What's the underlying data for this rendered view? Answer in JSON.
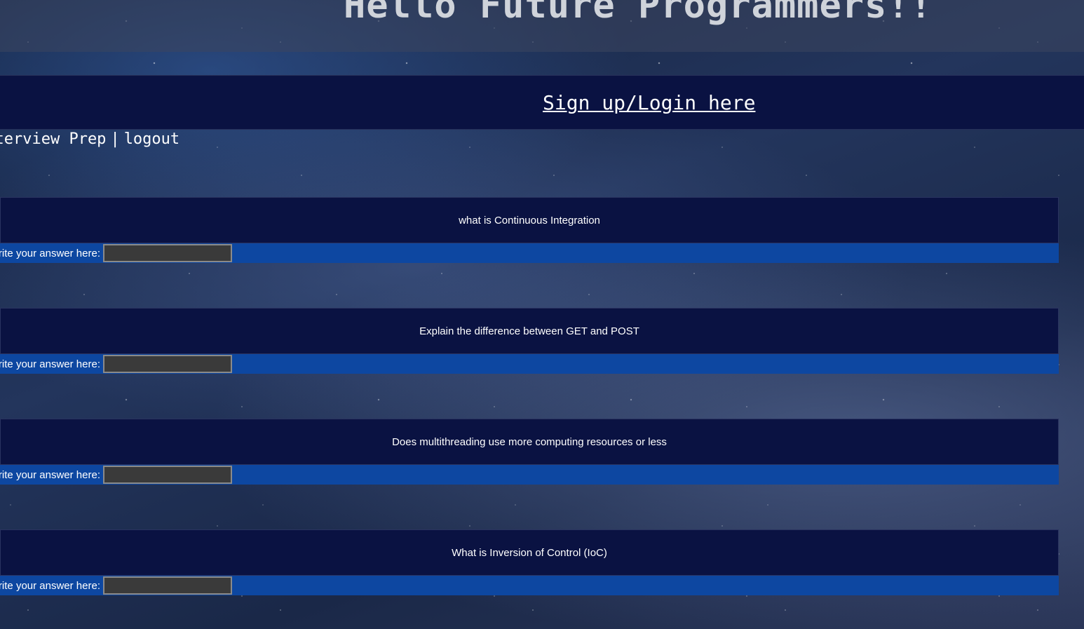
{
  "header": {
    "title": "Hello Future Programmers!!"
  },
  "login": {
    "link_text": "Sign up/Login here"
  },
  "nav": {
    "prep_label": "Interview Prep",
    "separator": "|",
    "logout_label": "logout"
  },
  "questions": [
    {
      "text": "what is Continuous Integration",
      "answer_label": "Write your answer here:",
      "answer_value": ""
    },
    {
      "text": "Explain the difference between GET and POST",
      "answer_label": "Write your answer here:",
      "answer_value": ""
    },
    {
      "text": "Does multithreading use more computing resources or less",
      "answer_label": "Write your answer here:",
      "answer_value": ""
    },
    {
      "text": "What is Inversion of Control (IoC)",
      "answer_label": "Write your answer here:",
      "answer_value": ""
    }
  ],
  "colors": {
    "dark_navy": "#0a1242",
    "answer_blue": "#0d47a1",
    "input_gray": "#3a3a3a"
  }
}
